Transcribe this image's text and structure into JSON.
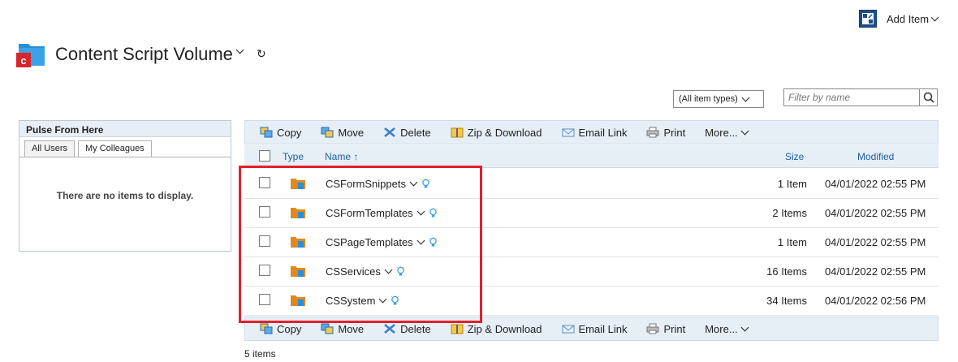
{
  "header": {
    "add_item_label": "Add Item",
    "volume_title": "Content Script Volume",
    "refresh_glyph": "↻"
  },
  "filters": {
    "item_type_selected": "(All item types)",
    "filter_placeholder": "Filter by name"
  },
  "pulse": {
    "title": "Pulse From Here",
    "tabs": [
      "All Users",
      "My Colleagues"
    ],
    "active_tab": "My Colleagues",
    "empty_message": "There are no items to display."
  },
  "toolbar": {
    "copy": "Copy",
    "move": "Move",
    "delete": "Delete",
    "zip_download": "Zip & Download",
    "email_link": "Email Link",
    "print": "Print",
    "more": "More..."
  },
  "table": {
    "columns": {
      "type": "Type",
      "name": "Name ↑",
      "size": "Size",
      "modified": "Modified"
    },
    "rows": [
      {
        "name": "CSFormSnippets",
        "size": "1 Item",
        "modified": "04/01/2022 02:55 PM"
      },
      {
        "name": "CSFormTemplates",
        "size": "2 Items",
        "modified": "04/01/2022 02:55 PM"
      },
      {
        "name": "CSPageTemplates",
        "size": "1 Item",
        "modified": "04/01/2022 02:55 PM"
      },
      {
        "name": "CSServices",
        "size": "16 Items",
        "modified": "04/01/2022 02:55 PM"
      },
      {
        "name": "CSSystem",
        "size": "34 Items",
        "modified": "04/01/2022 02:56 PM"
      }
    ],
    "item_count": "5 items"
  },
  "icons": {
    "volume": "content-script-volume-icon",
    "folder": "folder-icon",
    "smart_view": "lightbulb-icon"
  },
  "colors": {
    "accent_blue": "#1f5fa8",
    "toolbar_bg": "#e6eef6",
    "highlight_red": "#e1202b",
    "volume_icon_red": "#d6262c",
    "volume_icon_blue": "#2b8fd6"
  }
}
